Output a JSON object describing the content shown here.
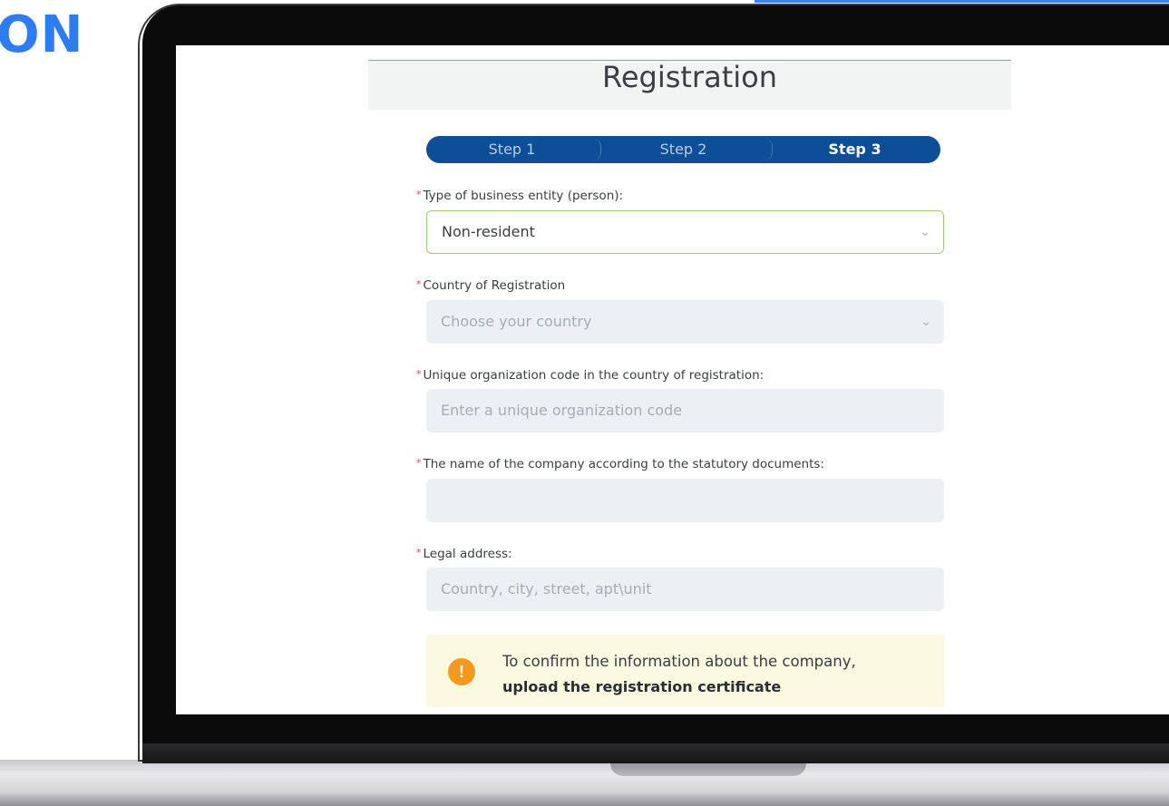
{
  "corner_text": "ON",
  "page": {
    "title": "Registration"
  },
  "stepper": {
    "steps": [
      "Step 1",
      "Step 2",
      "Step 3"
    ],
    "active_step": "Step 3"
  },
  "form": {
    "required_mark": "*",
    "business_entity": {
      "label": "Type of business entity (person):",
      "value": "Non-resident"
    },
    "country": {
      "label": "Country of Registration",
      "placeholder": "Choose your country"
    },
    "org_code": {
      "label": "Unique organization code in the country of registration:",
      "placeholder": "Enter a unique organization code"
    },
    "company_name": {
      "label": "The name of the company according to the statutory documents:",
      "value": ""
    },
    "legal_address": {
      "label": "Legal address:",
      "placeholder": "Country, city, street, apt\\unit"
    }
  },
  "notice": {
    "icon": "exclamation-icon",
    "text": "To confirm the information about the company,",
    "link": "upload the registration certificate",
    "color": "#f39a1c"
  },
  "colors": {
    "stepper": "#0d4f96",
    "accent": "#2e7df0"
  }
}
